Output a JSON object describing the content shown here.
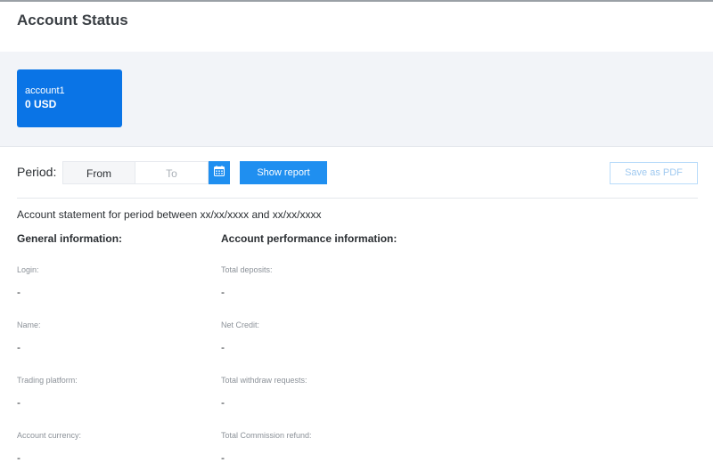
{
  "page": {
    "title": "Account Status"
  },
  "accounts": [
    {
      "name": "account1",
      "balance": "0 USD",
      "color": "#0a74e6"
    }
  ],
  "period": {
    "label": "Period:",
    "from_placeholder": "From",
    "to_placeholder": "To",
    "calendar_icon": "calendar-icon",
    "show_report_label": "Show report",
    "save_pdf_label": "Save as PDF"
  },
  "statement": {
    "text": "Account statement for period between xx/xx/xxxx and xx/xx/xxxx"
  },
  "general": {
    "heading": "General information:",
    "fields": [
      {
        "label": "Login:",
        "value": "-"
      },
      {
        "label": "Name:",
        "value": "-"
      },
      {
        "label": "Trading platform:",
        "value": "-"
      },
      {
        "label": "Account currency:",
        "value": "-"
      }
    ]
  },
  "performance": {
    "heading": "Account performance information:",
    "fields": [
      {
        "label": "Total deposits:",
        "value": "-"
      },
      {
        "label": "Net Credit:",
        "value": "-"
      },
      {
        "label": "Total withdraw requests:",
        "value": "-"
      },
      {
        "label": "Total Commission refund:",
        "value": "-"
      }
    ]
  },
  "colors": {
    "accent": "#1f8ff0",
    "card": "#0a74e6",
    "band": "#f2f4f8"
  }
}
